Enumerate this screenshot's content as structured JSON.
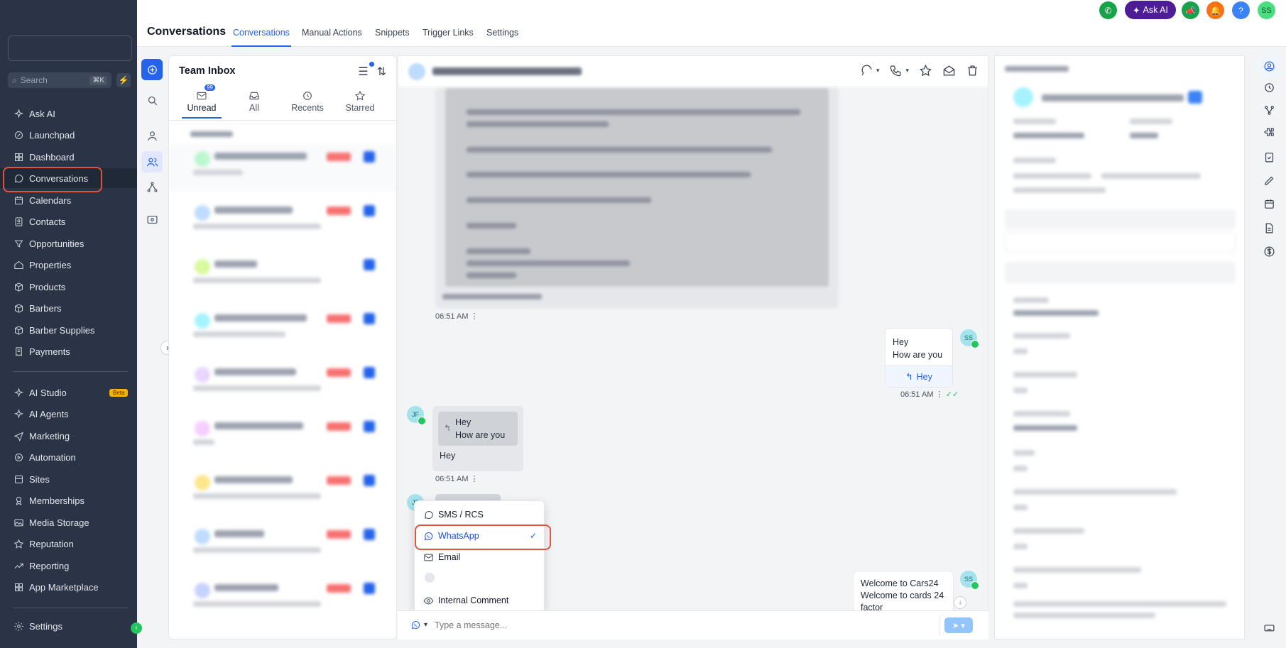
{
  "sidebar": {
    "search_placeholder": "Search",
    "search_shortcut": "⌘K",
    "items": [
      {
        "label": "Ask AI",
        "icon": "sparkle-icon"
      },
      {
        "label": "Launchpad",
        "icon": "rocket-icon"
      },
      {
        "label": "Dashboard",
        "icon": "grid-icon"
      },
      {
        "label": "Conversations",
        "icon": "chat-icon"
      },
      {
        "label": "Calendars",
        "icon": "calendar-icon"
      },
      {
        "label": "Contacts",
        "icon": "contacts-icon"
      },
      {
        "label": "Opportunities",
        "icon": "filter-icon"
      },
      {
        "label": "Properties",
        "icon": "home-icon"
      },
      {
        "label": "Products",
        "icon": "box-icon"
      },
      {
        "label": "Barbers",
        "icon": "box-icon"
      },
      {
        "label": "Barber Supplies",
        "icon": "box-icon"
      },
      {
        "label": "Payments",
        "icon": "receipt-icon"
      },
      {
        "label": "AI Studio",
        "icon": "ai-studio-icon",
        "badge": "Beta"
      },
      {
        "label": "AI Agents",
        "icon": "sparkle-icon"
      },
      {
        "label": "Marketing",
        "icon": "send-icon"
      },
      {
        "label": "Automation",
        "icon": "automation-icon"
      },
      {
        "label": "Sites",
        "icon": "globe-icon"
      },
      {
        "label": "Memberships",
        "icon": "award-icon"
      },
      {
        "label": "Media Storage",
        "icon": "image-icon"
      },
      {
        "label": "Reputation",
        "icon": "star-icon"
      },
      {
        "label": "Reporting",
        "icon": "trend-icon"
      },
      {
        "label": "App Marketplace",
        "icon": "grid-icon"
      }
    ],
    "settings_label": "Settings",
    "active": "Conversations"
  },
  "header": {
    "title": "Conversations",
    "tabs": [
      "Conversations",
      "Manual Actions",
      "Snippets",
      "Trigger Links",
      "Settings"
    ],
    "active_tab": "Conversations",
    "ask_ai": "Ask AI",
    "user_initials": "SS",
    "help": "?"
  },
  "inbox": {
    "title": "Team Inbox",
    "tabs": [
      {
        "label": "Unread",
        "badge": "99"
      },
      {
        "label": "All"
      },
      {
        "label": "Recents"
      },
      {
        "label": "Starred"
      }
    ],
    "active_tab": "Unread"
  },
  "chat": {
    "messages": {
      "t1": "06:51 AM",
      "out1_line1": "Hey",
      "out1_line2": "How are you",
      "out1_reply": "Hey",
      "t2": "06:51 AM",
      "in1_quote1": "Hey",
      "in1_quote2": "How are you",
      "in1_text": "Hey",
      "t3": "06:51 AM",
      "out2_line1": "Welcome to Cars24",
      "out2_line2": "Welcome to cards 24",
      "out2_line3": "factor"
    },
    "avatars": {
      "ss": "SS",
      "jf": "JF"
    },
    "composer_placeholder": "Type a message..."
  },
  "channel_menu": {
    "items": [
      "SMS / RCS",
      "WhatsApp",
      "Email",
      "Internal Comment"
    ],
    "selected": "WhatsApp"
  },
  "colors": {
    "sidebar_bg": "#2a3446",
    "accent": "#2563eb",
    "highlight": "#e0533d",
    "whatsapp": "#22c55e"
  }
}
